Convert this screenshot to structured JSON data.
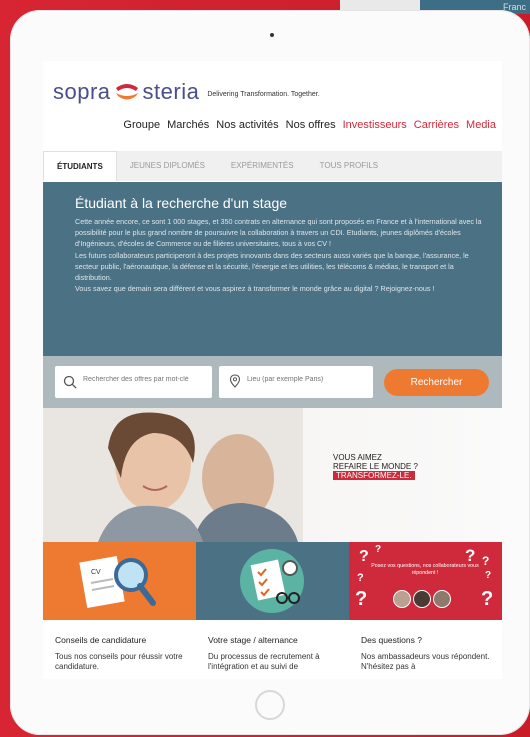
{
  "corner": {
    "label": "Franc"
  },
  "brand": {
    "logo_left": "sopra",
    "logo_right": "steria",
    "tagline": "Delivering Transformation. Together."
  },
  "nav": {
    "items": [
      "Groupe",
      "Marchés",
      "Nos activités",
      "Nos offres"
    ],
    "red_items": [
      "Investisseurs",
      "Carrières",
      "Media"
    ]
  },
  "tabs": [
    "ÉTUDIANTS",
    "JEUNES DIPLOMÉS",
    "EXPÉRIMENTÉS",
    "TOUS PROFILS"
  ],
  "hero": {
    "title": "Étudiant à la recherche d'un stage",
    "body": [
      "Cette année encore, ce sont 1 000 stages, et 350 contrats en alternance qui sont proposés en France et à l'international avec la possibilité pour le plus grand nombre de poursuivre la collaboration à travers un CDI.",
      "Etudiants, jeunes diplômés d'écoles d'Ingénieurs, d'écoles de Commerce ou de filières universitaires, tous à vos CV !",
      "Les futurs collaborateurs participeront à des projets innovants dans des secteurs aussi variés que la banque, l'assurance, le secteur public, l'aéronautique, la défense et la sécurité, l'énergie et les utilities, les télécoms & médias, le transport et la distribution.",
      "Vous savez que demain sera différent et vous aspirez à transformer le monde grâce au digital ? Rejoignez-nous !"
    ]
  },
  "search": {
    "keyword_placeholder": "Rechercher des offres par mot-clé",
    "location_placeholder": "Lieu (par exemple Paris)",
    "button": "Rechercher"
  },
  "banner": {
    "line1": "VOUS AIMEZ",
    "line2": "REFAIRE LE MONDE ?",
    "line3": "TRANSFORMEZ-LE."
  },
  "cards": [
    {
      "title": "Conseils de candidature",
      "desc": "Tous nos conseils pour réussir votre candidature.",
      "color": "#ee7a32"
    },
    {
      "title": "Votre stage / alternance",
      "desc": "Du processus de recrutement à l'intégration et au suivi de",
      "color": "#4b7185"
    },
    {
      "title": "Des questions ?",
      "desc": "Nos ambassadeurs vous répondent. N'hésitez pas à",
      "color": "#cf2a3b",
      "overlay": "Posez vos questions, nos collaborateurs vous répondent !"
    }
  ]
}
